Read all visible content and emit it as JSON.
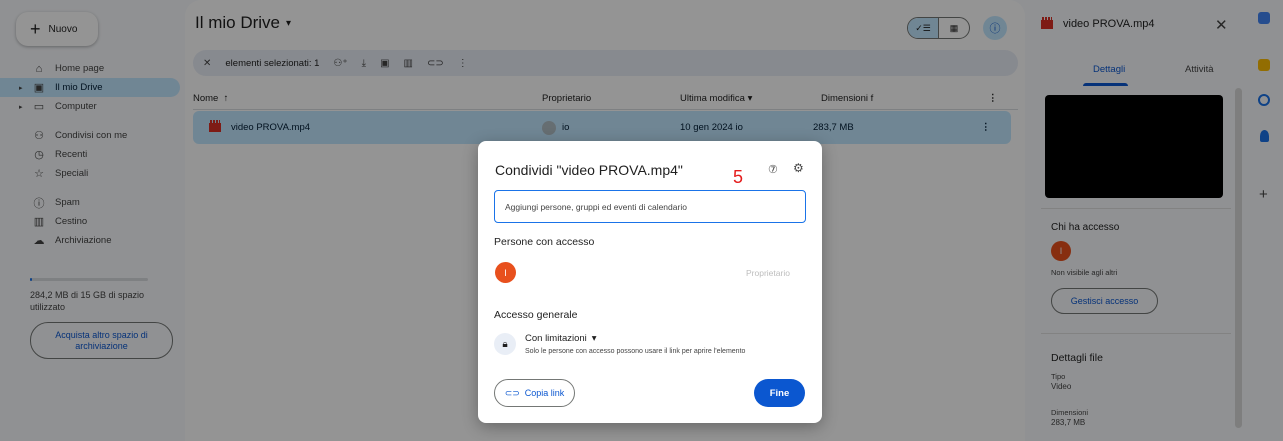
{
  "sidebar": {
    "new_label": "Nuovo",
    "items": [
      {
        "label": "Home page",
        "icon": "home-icon",
        "glyph": "⌂"
      },
      {
        "label": "Il mio Drive",
        "icon": "drive-icon",
        "glyph": "▣"
      },
      {
        "label": "Computer",
        "icon": "computer-icon",
        "glyph": "▭"
      },
      {
        "label": "Condivisi con me",
        "icon": "shared-icon",
        "glyph": "👥"
      },
      {
        "label": "Recenti",
        "icon": "clock-icon",
        "glyph": "◷"
      },
      {
        "label": "Speciali",
        "icon": "star-icon",
        "glyph": "☆"
      },
      {
        "label": "Spam",
        "icon": "spam-icon",
        "glyph": "ⓘ"
      },
      {
        "label": "Cestino",
        "icon": "trash-icon",
        "glyph": "🗑"
      },
      {
        "label": "Archiviazione",
        "icon": "cloud-icon",
        "glyph": "☁"
      }
    ],
    "storage_text": "284,2 MB di 15 GB di spazio utilizzato",
    "storage_fraction": 0.02,
    "buy_label": "Acquista altro spazio di archiviazione"
  },
  "main": {
    "title": "Il mio Drive",
    "selection_label": "elementi selezionati: 1",
    "columns": {
      "name": "Nome",
      "owner": "Proprietario",
      "modified": "Ultima modifica",
      "size": "Dimensioni f"
    },
    "row": {
      "name": "video PROVA.mp4",
      "owner": "io",
      "modified": "10 gen 2024 io",
      "size": "283,7 MB"
    }
  },
  "details": {
    "file_name": "video PROVA.mp4",
    "tab_details": "Dettagli",
    "tab_activity": "Attività",
    "access_title": "Chi ha accesso",
    "avatar_letter": "I",
    "not_visible": "Non visibile agli altri",
    "manage_label": "Gestisci accesso",
    "file_details_title": "Dettagli file",
    "type_label": "Tipo",
    "type_value": "Video",
    "size_label": "Dimensioni",
    "size_value": "283,7 MB"
  },
  "dialog": {
    "title": "Condividi \"video PROVA.mp4\"",
    "input_placeholder": "Aggiungi persone, gruppi ed eventi di calendario",
    "annotation": "5",
    "people_title": "Persone con accesso",
    "avatar_letter": "I",
    "owner_role": "Proprietario",
    "general_title": "Accesso generale",
    "restriction": "Con limitazioni",
    "restriction_desc": "Solo le persone con accesso possono usare il link per aprire l'elemento",
    "copy_label": "Copia link",
    "done_label": "Fine"
  },
  "colors": {
    "accent": "#0b57d0",
    "selected": "#c2e7ff",
    "avatar": "#e8501d",
    "video": "#d93025",
    "annotation": "#e41c1c"
  }
}
